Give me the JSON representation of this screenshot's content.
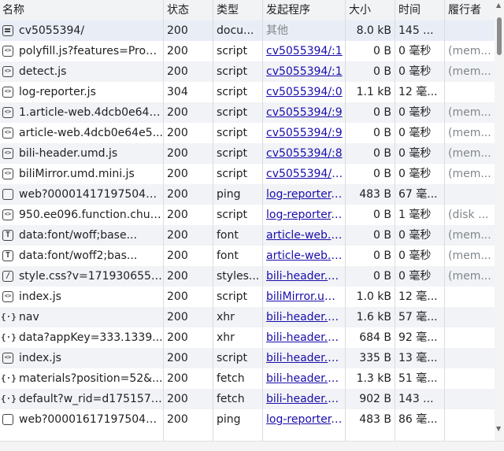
{
  "columns": {
    "name": "名称",
    "status": "状态",
    "type": "类型",
    "initiator": "发起程序",
    "size": "大小",
    "time": "时间",
    "fulfilled": "履行者"
  },
  "rows": [
    {
      "icon": "doc",
      "name": "cv5055394/",
      "status": "200",
      "type": "docu...",
      "initiator": "其他",
      "initiator_link": false,
      "size": "8.0 kB",
      "time": "145 ...",
      "fulfilled": ""
    },
    {
      "icon": "code",
      "name": "polyfill.js?features=Prom...",
      "status": "200",
      "type": "script",
      "initiator": "cv5055394/:1",
      "initiator_link": true,
      "size": "0 B",
      "time": "0 毫秒",
      "fulfilled": "(mem..."
    },
    {
      "icon": "code",
      "name": "detect.js",
      "status": "200",
      "type": "script",
      "initiator": "cv5055394/:1",
      "initiator_link": true,
      "size": "0 B",
      "time": "0 毫秒",
      "fulfilled": "(mem..."
    },
    {
      "icon": "code",
      "name": "log-reporter.js",
      "status": "304",
      "type": "script",
      "initiator": "cv5055394/:0",
      "initiator_link": true,
      "size": "1.1 kB",
      "time": "12 毫...",
      "fulfilled": ""
    },
    {
      "icon": "code",
      "name": "1.article-web.4dcb0e64e...",
      "status": "200",
      "type": "script",
      "initiator": "cv5055394/:9",
      "initiator_link": true,
      "size": "0 B",
      "time": "0 毫秒",
      "fulfilled": "(mem..."
    },
    {
      "icon": "code",
      "name": "article-web.4dcb0e64e5...",
      "status": "200",
      "type": "script",
      "initiator": "cv5055394/:9",
      "initiator_link": true,
      "size": "0 B",
      "time": "0 毫秒",
      "fulfilled": "(mem..."
    },
    {
      "icon": "code",
      "name": "bili-header.umd.js",
      "status": "200",
      "type": "script",
      "initiator": "cv5055394/:8",
      "initiator_link": true,
      "size": "0 B",
      "time": "0 毫秒",
      "fulfilled": "(mem..."
    },
    {
      "icon": "code",
      "name": "biliMirror.umd.mini.js",
      "status": "200",
      "type": "script",
      "initiator": "cv5055394/:23...",
      "initiator_link": true,
      "size": "0 B",
      "time": "0 毫秒",
      "fulfilled": "(mem..."
    },
    {
      "icon": "ping",
      "name": "web?0000141719750452...",
      "status": "200",
      "type": "ping",
      "initiator": "log-reporter.js:...",
      "initiator_link": true,
      "size": "483 B",
      "time": "67 毫...",
      "fulfilled": ""
    },
    {
      "icon": "code",
      "name": "950.ee096.function.chun...",
      "status": "200",
      "type": "script",
      "initiator": "log-reporter.js:...",
      "initiator_link": true,
      "size": "0 B",
      "time": "1 毫秒",
      "fulfilled": "(disk ..."
    },
    {
      "icon": "font",
      "name": "data:font/woff;base...",
      "status": "200",
      "type": "font",
      "initiator": "article-web.4d...",
      "initiator_link": true,
      "size": "0 B",
      "time": "0 毫秒",
      "fulfilled": "(mem..."
    },
    {
      "icon": "font",
      "name": "data:font/woff2;bas...",
      "status": "200",
      "type": "font",
      "initiator": "article-web.4d...",
      "initiator_link": true,
      "size": "0 B",
      "time": "0 毫秒",
      "fulfilled": "(mem..."
    },
    {
      "icon": "style",
      "name": "style.css?v=1719306550...",
      "status": "200",
      "type": "styles...",
      "initiator": "bili-header.um...",
      "initiator_link": true,
      "size": "0 B",
      "time": "0 毫秒",
      "fulfilled": "(mem..."
    },
    {
      "icon": "code",
      "name": "index.js",
      "status": "200",
      "type": "script",
      "initiator": "biliMirror.umd....",
      "initiator_link": true,
      "size": "1.0 kB",
      "time": "12 毫...",
      "fulfilled": ""
    },
    {
      "icon": "xhr",
      "name": "nav",
      "status": "200",
      "type": "xhr",
      "initiator": "bili-header.um...",
      "initiator_link": true,
      "size": "1.6 kB",
      "time": "57 毫...",
      "fulfilled": ""
    },
    {
      "icon": "xhr",
      "name": "data?appKey=333.1339...",
      "status": "200",
      "type": "xhr",
      "initiator": "bili-header.um...",
      "initiator_link": true,
      "size": "684 B",
      "time": "92 毫...",
      "fulfilled": ""
    },
    {
      "icon": "code",
      "name": "index.js",
      "status": "200",
      "type": "script",
      "initiator": "bili-header.um...",
      "initiator_link": true,
      "size": "335 B",
      "time": "13 毫...",
      "fulfilled": ""
    },
    {
      "icon": "xhr",
      "name": "materials?position=52&...",
      "status": "200",
      "type": "fetch",
      "initiator": "bili-header.um...",
      "initiator_link": true,
      "size": "1.3 kB",
      "time": "51 毫...",
      "fulfilled": ""
    },
    {
      "icon": "xhr",
      "name": "default?w_rid=d1751576...",
      "status": "200",
      "type": "fetch",
      "initiator": "bili-header.um...",
      "initiator_link": true,
      "size": "902 B",
      "time": "143 ...",
      "fulfilled": ""
    },
    {
      "icon": "ping",
      "name": "web?0000161719750452...",
      "status": "200",
      "type": "ping",
      "initiator": "log-reporter.js:...",
      "initiator_link": true,
      "size": "483 B",
      "time": "86 毫...",
      "fulfilled": ""
    }
  ]
}
